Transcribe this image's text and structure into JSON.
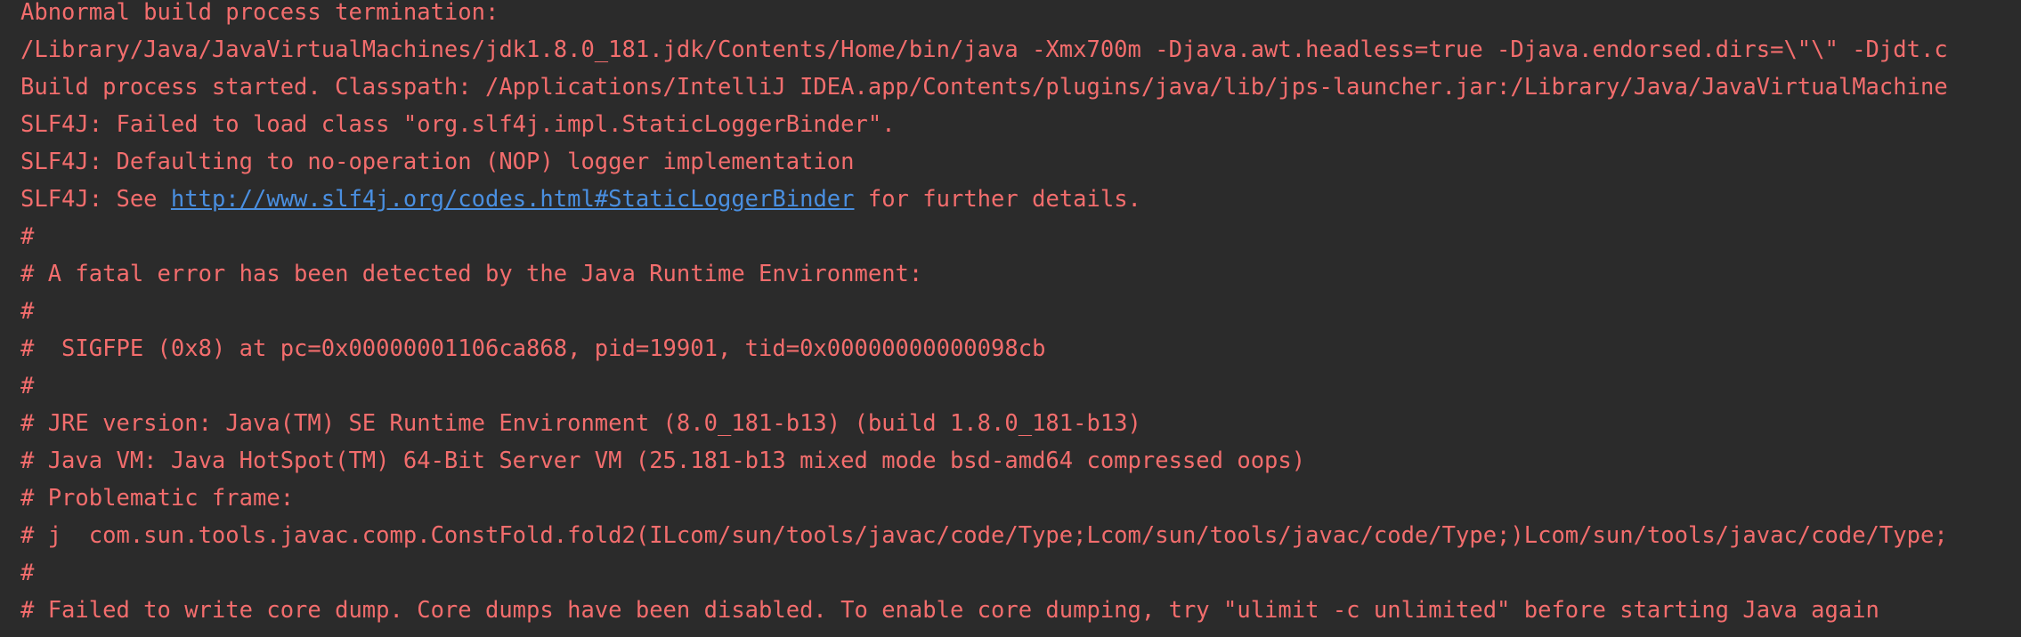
{
  "console": {
    "colors": {
      "background": "#2b2b2b",
      "error_text": "#f36d6d",
      "link": "#4a8fe0"
    },
    "lines": [
      "Abnormal build process termination:",
      "/Library/Java/JavaVirtualMachines/jdk1.8.0_181.jdk/Contents/Home/bin/java -Xmx700m -Djava.awt.headless=true -Djava.endorsed.dirs=\\\"\\\" -Djdt.c",
      "Build process started. Classpath: /Applications/IntelliJ IDEA.app/Contents/plugins/java/lib/jps-launcher.jar:/Library/Java/JavaVirtualMachine",
      "SLF4J: Failed to load class \"org.slf4j.impl.StaticLoggerBinder\".",
      "SLF4J: Defaulting to no-operation (NOP) logger implementation",
      "#",
      "# A fatal error has been detected by the Java Runtime Environment:",
      "#",
      "#  SIGFPE (0x8) at pc=0x00000001106ca868, pid=19901, tid=0x00000000000098cb",
      "#",
      "# JRE version: Java(TM) SE Runtime Environment (8.0_181-b13) (build 1.8.0_181-b13)",
      "# Java VM: Java HotSpot(TM) 64-Bit Server VM (25.181-b13 mixed mode bsd-amd64 compressed oops)",
      "# Problematic frame:",
      "# j  com.sun.tools.javac.comp.ConstFold.fold2(ILcom/sun/tools/javac/code/Type;Lcom/sun/tools/javac/code/Type;)Lcom/sun/tools/javac/code/Type;",
      "#",
      "# Failed to write core dump. Core dumps have been disabled. To enable core dumping, try \"ulimit -c unlimited\" before starting Java again"
    ],
    "see_line": {
      "prefix": "SLF4J: See ",
      "link_text": "http://www.slf4j.org/codes.html#StaticLoggerBinder",
      "suffix": " for further details."
    }
  }
}
